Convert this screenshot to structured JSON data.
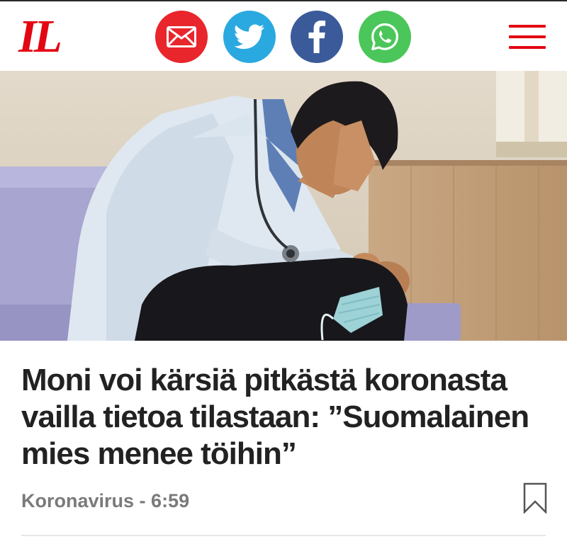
{
  "header": {
    "logo_text": "IL",
    "share_buttons": [
      {
        "name": "email",
        "color": "#e8262b",
        "icon": "envelope-icon"
      },
      {
        "name": "twitter",
        "color": "#2aa9e0",
        "icon": "twitter-bird-icon"
      },
      {
        "name": "facebook",
        "color": "#3b5a9a",
        "icon": "facebook-f-icon"
      },
      {
        "name": "whatsapp",
        "color": "#4bc65a",
        "icon": "whatsapp-icon"
      }
    ],
    "menu_icon": "hamburger-menu-icon",
    "brand_color": "#e30613"
  },
  "article": {
    "headline": "Moni voi kärsiä pitkästä koronasta vailla tietoa tilastaan: ”Suomalainen mies menee töihin”",
    "category": "Koronavirus",
    "separator": " - ",
    "time": "6:59",
    "bookmark_icon": "bookmark-icon"
  }
}
